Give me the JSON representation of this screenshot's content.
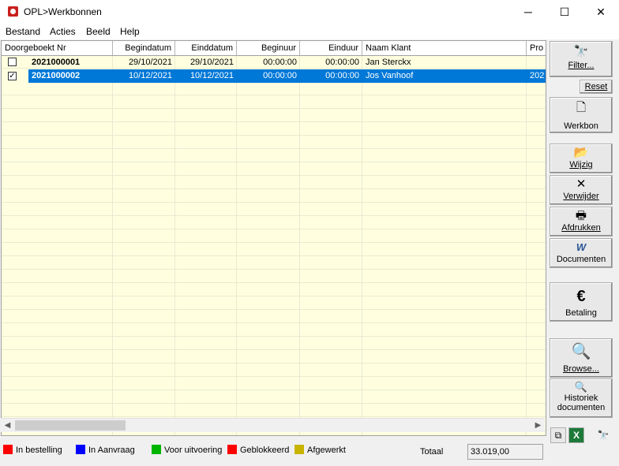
{
  "window": {
    "title": "OPL>Werkbonnen",
    "minimize_glyph": "─",
    "maximize_glyph": "☐",
    "close_glyph": "✕"
  },
  "menu": [
    "Bestand",
    "Acties",
    "Beeld",
    "Help"
  ],
  "grid": {
    "headers": [
      "Doorgeboekt  Nr",
      "Begindatum",
      "Einddatum",
      "Beginuur",
      "Einduur",
      "Naam Klant",
      "Pro"
    ],
    "rows": [
      {
        "checked": false,
        "checkmark": "",
        "nr": "2021000001",
        "begindatum": "29/10/2021",
        "einddatum": "29/10/2021",
        "beginuur": "00:00:00",
        "einduur": "00:00:00",
        "klant": "Jan Sterckx",
        "pro": ""
      },
      {
        "checked": true,
        "checkmark": "✓",
        "nr": "2021000002",
        "begindatum": "10/12/2021",
        "einddatum": "10/12/2021",
        "beginuur": "00:00:00",
        "einduur": "00:00:00",
        "klant": "Jos Vanhoof",
        "pro": "202"
      }
    ],
    "selected_row": 1
  },
  "scroll": {
    "left_glyph": "◀",
    "right_glyph": "▶"
  },
  "buttons": {
    "filter": "Filter...",
    "reset": "Reset",
    "werkbon": "Werkbon",
    "wijzig": "Wijzig",
    "verwijder": "Verwijder",
    "afdrukken": "Afdrukken",
    "documenten": "Documenten",
    "betaling": "Betaling",
    "browse": "Browse...",
    "historiek_1": "Historiek",
    "historiek_2": "documenten"
  },
  "icons": {
    "filter": "binoculars-icon",
    "werkbon": "new-document-icon",
    "wijzig": "open-folder-icon",
    "verwijder": "delete-x-icon",
    "afdrukken": "printer-icon",
    "documenten": "word-document-icon",
    "betaling": "euro-icon",
    "browse": "folder-search-icon",
    "historiek": "document-history-icon"
  },
  "icon_glyphs": {
    "binoculars": "🔭",
    "document": "🗋",
    "folder": "📂",
    "x": "✕",
    "printer": "🖶",
    "word": "W",
    "euro": "€",
    "search": "🔍",
    "copy": "⧉",
    "excel": "X"
  },
  "legend": [
    {
      "label": "In bestelling",
      "color": "#ff0000"
    },
    {
      "label": "In Aanvraag",
      "color": "#0000ff"
    },
    {
      "label": "Voor uitvoering",
      "color": "#00b400"
    },
    {
      "label": "Geblokkeerd",
      "color": "#ff0000"
    },
    {
      "label": "Afgewerkt",
      "color": "#c8b400"
    }
  ],
  "total": {
    "label": "Totaal",
    "value": "33.019,00"
  },
  "colors": {
    "grid_bg": "#ffffe0",
    "selection": "#0078d7"
  }
}
